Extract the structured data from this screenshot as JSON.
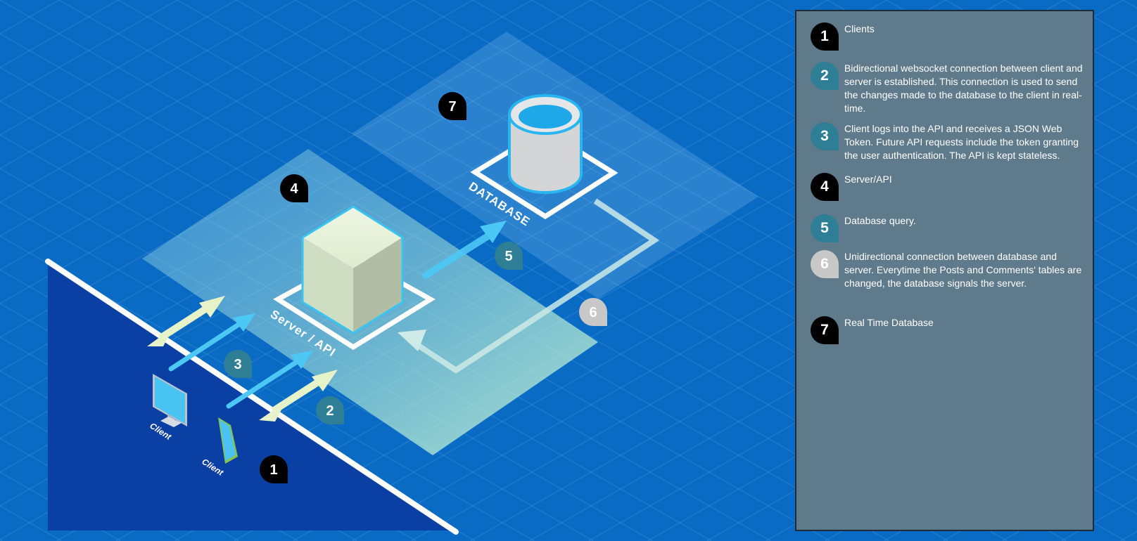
{
  "diagram": {
    "labels": {
      "database": "DATABASE",
      "server": "Server / API",
      "client_desktop": "Client",
      "client_phone": "Client"
    },
    "badges": {
      "b1": "1",
      "b2": "2",
      "b3": "3",
      "b4": "4",
      "b5": "5",
      "b6": "6",
      "b7": "7"
    }
  },
  "legend": {
    "items": [
      {
        "num": "1",
        "text": "Clients",
        "color": "#000000"
      },
      {
        "num": "2",
        "text": "Bidirectional websocket connection between client and server is established. This connection is used to send the changes made to the database to the client in real-time.",
        "color": "#2e7e96"
      },
      {
        "num": "3",
        "text": "Client logs into the API and receives a JSON Web Token. Future API requests include the token granting the user authentication. The API is kept stateless.",
        "color": "#2e7e96"
      },
      {
        "num": "4",
        "text": "Server/API",
        "color": "#000000"
      },
      {
        "num": "5",
        "text": "Database query.",
        "color": "#2e7e96"
      },
      {
        "num": "6",
        "text": "Unidirectional connection between database and server. Everytime the Posts and Comments' tables are changed, the database signals the server.",
        "color": "#c8c8c8"
      },
      {
        "num": "7",
        "text": "Real Time Database",
        "color": "#000000"
      }
    ]
  },
  "colors": {
    "background": "#0a6bc4",
    "floor": "#0a3fa3",
    "legend_panel": "#5f7a8a",
    "badge_dark": "#000000",
    "badge_teal": "#2e7e96",
    "badge_light": "#c8c8c8",
    "arrow_cream": "#e6f2c7",
    "arrow_cyan": "#4cc8f5"
  }
}
